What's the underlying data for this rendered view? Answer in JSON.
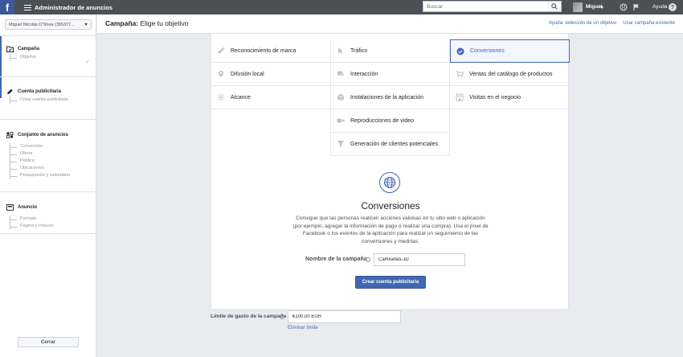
{
  "topbar": {
    "logo": "f",
    "app_title": "Administrador de anuncios",
    "search_placeholder": "Buscar",
    "user_name": "Miguel",
    "help_label": "Ayuda",
    "help_badge": "?"
  },
  "sidebar": {
    "account": "Miguel Nicolás O'Shea (355377...",
    "sections": {
      "campaign": {
        "title": "Campaña",
        "items": [
          "Objetivo"
        ]
      },
      "ad_account": {
        "title": "Cuenta publicitaria",
        "items": [
          "Crear cuenta publicitaria"
        ]
      },
      "ad_set": {
        "title": "Conjunto de anuncios",
        "items": [
          "Conversión",
          "Oferta",
          "Público",
          "Ubicaciones",
          "Presupuesto y calendario"
        ]
      },
      "ad": {
        "title": "Anuncio",
        "items": [
          "Formato",
          "Página y enlaces"
        ]
      }
    },
    "close_label": "Cerrar"
  },
  "header": {
    "title_bold": "Campaña:",
    "title_rest": " Elige tu objetivo",
    "help_link": "Ayuda: selección de un objetivo",
    "existing_link": "Usar campaña existente"
  },
  "objectives": {
    "brand_awareness": "Reconocimiento de marca",
    "traffic": "Tráfico",
    "conversions": "Conversiones",
    "local_awareness": "Difusión local",
    "engagement": "Interacción",
    "catalog_sales": "Ventas del catálogo de productos",
    "reach": "Alcance",
    "app_installs": "Instalaciones de la aplicación",
    "store_visits": "Visitas en el negocio",
    "video_views": "Reproducciones de video",
    "lead_generation": "Generación de clientes potenciales"
  },
  "detail": {
    "title": "Conversiones",
    "description": "Consigue que las personas realicen acciones valiosas en tu sitio web o aplicación (por ejemplo, agregar la información de pago o realizar una compra). Usa el píxel de Facebook o los eventos de la aplicación para realizar un seguimiento de las conversiones y medirlas.",
    "campaign_name_label": "Nombre de la campaña",
    "campaign_name_value": "Camisetas-JD",
    "create_button": "Crear cuenta publicitaria"
  },
  "spend_limit": {
    "label": "Límite de gasto de la campaña",
    "value": "€100,00 EUR",
    "remove_link": "Eliminar límite"
  },
  "colors": {
    "brand": "#4267b2",
    "topbar": "#4b4f56",
    "background": "#e9ebee"
  }
}
